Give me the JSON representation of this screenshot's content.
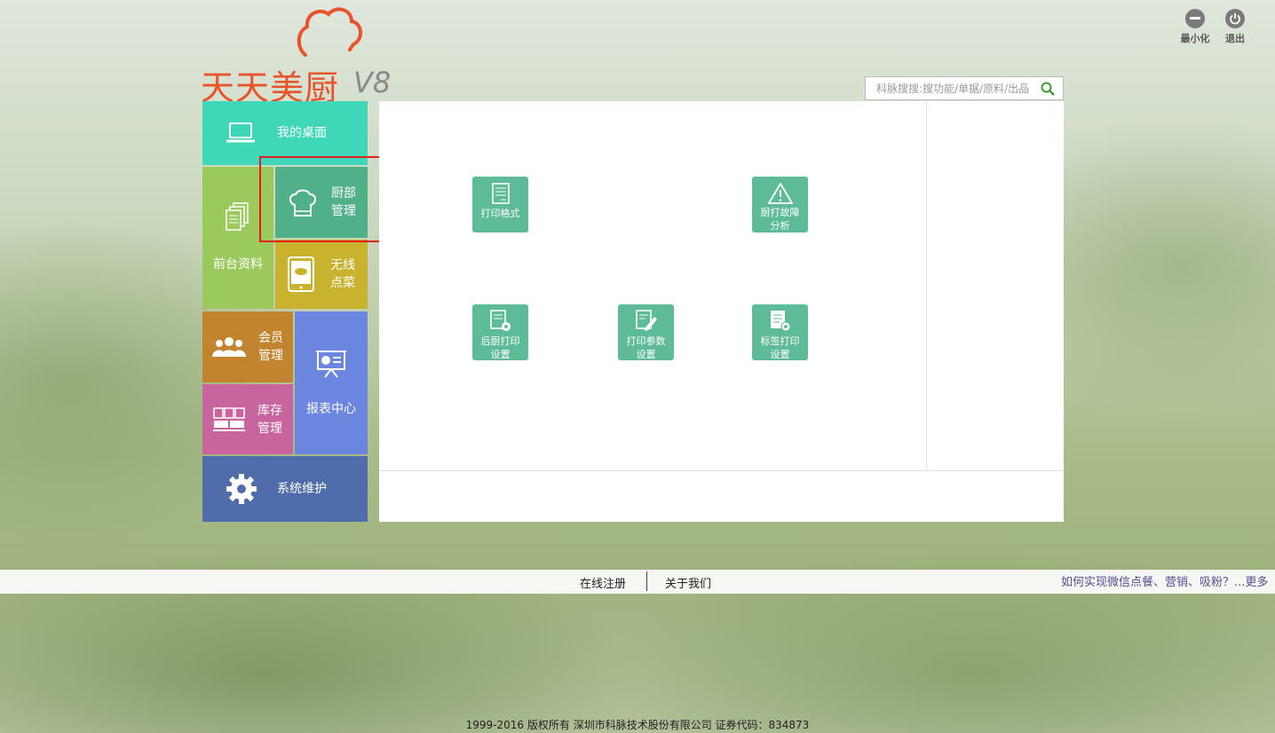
{
  "window_controls": {
    "minimize": "最小化",
    "exit": "退出"
  },
  "logo": {
    "name": "天天美厨",
    "version": "V8"
  },
  "search": {
    "placeholder": "科脉搜搜:搜功能/单据/原料/出品",
    "icon": "search-icon"
  },
  "menu": {
    "desktop": "我的桌面",
    "front": "前台资料",
    "kitchen_l1": "厨部",
    "kitchen_l2": "管理",
    "wireless_l1": "无线",
    "wireless_l2": "点菜",
    "member_l1": "会员",
    "member_l2": "管理",
    "stock_l1": "库存",
    "stock_l2": "管理",
    "report": "报表中心",
    "system": "系统维护"
  },
  "functions": {
    "print_format": "打印格式",
    "fault_l1": "厨打故障",
    "fault_l2": "分析",
    "back_l1": "后厨打印",
    "back_l2": "设置",
    "param_l1": "打印参数",
    "param_l2": "设置",
    "label_l1": "标签打印",
    "label_l2": "设置"
  },
  "footer": {
    "register": "在线注册",
    "about": "关于我们",
    "promo": "如何实现微信点餐、营销、吸粉？...更多",
    "copyright": "1999-2016  版权所有  深圳市科脉技术股份有限公司  证券代码：834873"
  },
  "colors": {
    "accent_logo": "#e8532a",
    "tile_desktop": "#3ed8b8",
    "tile_front": "#9cc95c",
    "tile_kitchen": "#4fb08a",
    "tile_wireless": "#c9b32e",
    "tile_member": "#c2842f",
    "tile_stock": "#c9659e",
    "tile_report": "#6b86df",
    "tile_system": "#4f6dab",
    "func_button": "#5dbb98",
    "highlight": "#e0201c"
  }
}
